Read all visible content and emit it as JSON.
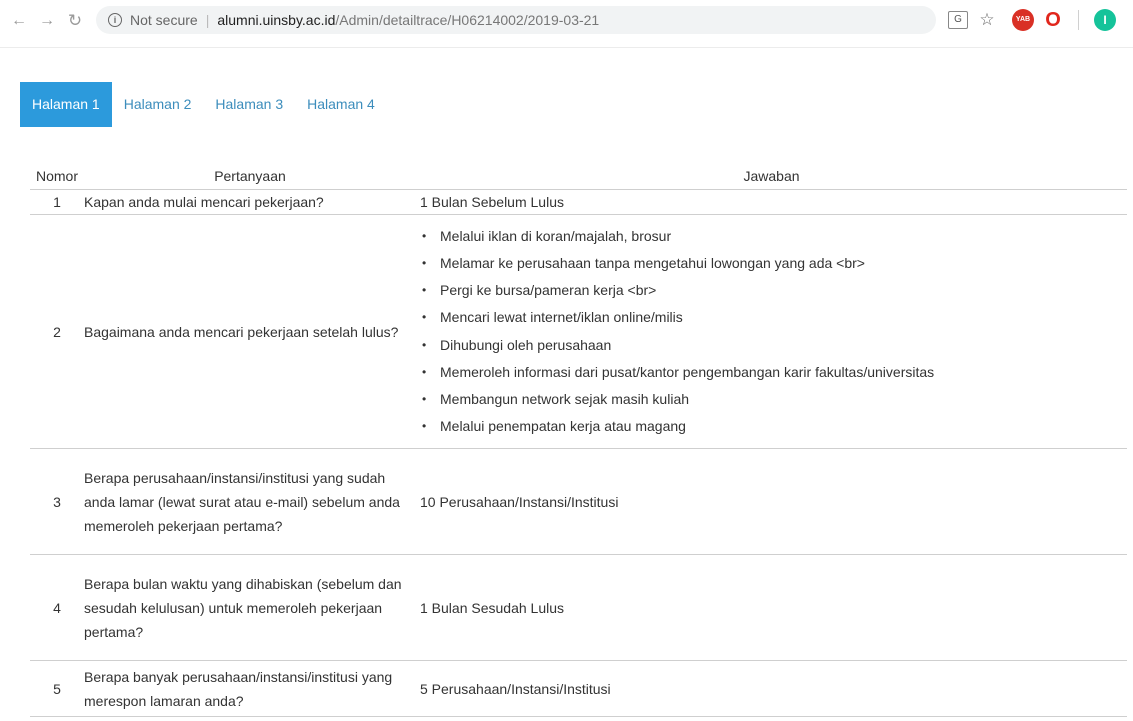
{
  "browser": {
    "security_label": "Not secure",
    "url_host": "alumni.uinsby.ac.id",
    "url_path": "/Admin/detailtrace/H06214002/2019-03-21",
    "icons": [
      "back-arrow-icon",
      "forward-arrow-icon",
      "reload-icon",
      "info-icon",
      "translate-icon",
      "star-icon",
      "yab-extension-icon",
      "opera-icon",
      "grammarly-icon"
    ]
  },
  "tabs": [
    {
      "label": "Halaman 1",
      "active": true
    },
    {
      "label": "Halaman 2",
      "active": false
    },
    {
      "label": "Halaman 3",
      "active": false
    },
    {
      "label": "Halaman 4",
      "active": false
    }
  ],
  "table": {
    "headers": {
      "nomor": "Nomor",
      "pertanyaan": "Pertanyaan",
      "jawaban": "Jawaban"
    },
    "rows": [
      {
        "no": "1",
        "question": "Kapan anda mulai mencari pekerjaan?",
        "answer": "1 Bulan Sebelum Lulus"
      },
      {
        "no": "2",
        "question": "Bagaimana anda mencari pekerjaan setelah lulus?",
        "answers": [
          "Melalui iklan di koran/majalah, brosur",
          "Melamar ke perusahaan tanpa mengetahui lowongan yang ada <br>",
          "Pergi ke bursa/pameran kerja <br>",
          "Mencari lewat internet/iklan online/milis",
          "Dihubungi oleh perusahaan",
          "Memeroleh informasi dari pusat/kantor pengembangan karir fakultas/universitas",
          "Membangun network sejak masih kuliah",
          "Melalui penempatan kerja atau magang"
        ]
      },
      {
        "no": "3",
        "question": "Berapa perusahaan/instansi/institusi yang sudah anda lamar (lewat surat atau e-mail) sebelum anda memeroleh pekerjaan pertama?",
        "answer": "10 Perusahaan/Instansi/Institusi"
      },
      {
        "no": "4",
        "question": "Berapa bulan waktu yang dihabiskan (sebelum dan sesudah kelulusan) untuk memeroleh pekerjaan pertama?",
        "answer": "1 Bulan Sesudah Lulus"
      },
      {
        "no": "5",
        "question": "Berapa banyak perusahaan/instansi/institusi yang merespon lamaran anda?",
        "answer": "5 Perusahaan/Instansi/Institusi"
      }
    ]
  }
}
